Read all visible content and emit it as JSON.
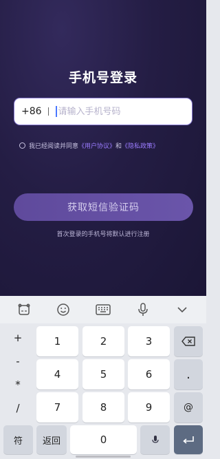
{
  "login": {
    "title": "手机号登录",
    "country_code": "+86",
    "phone_placeholder": "请输入手机号码",
    "phone_value": "",
    "agreement": {
      "prefix": "我已经阅读并同意",
      "user_agreement": "《用户协议》",
      "and": "和",
      "privacy_policy": "《隐私政策》"
    },
    "get_code_button": "获取短信验证码",
    "auto_register_hint": "首次登录的手机号将默认进行注册"
  },
  "keyboard": {
    "toolbar_icons": [
      "emoji-keyboard-icon",
      "smiley-icon",
      "keyboard-icon",
      "microphone-icon",
      "chevron-down-icon"
    ],
    "symbols": [
      "+",
      "-",
      "*",
      "/"
    ],
    "digits": [
      "1",
      "2",
      "3",
      "4",
      "5",
      "6",
      "7",
      "8",
      "9",
      "0"
    ],
    "dot": ".",
    "at": "@",
    "fu_label": "符",
    "back_label": "返回",
    "icons": {
      "backspace": "backspace-icon",
      "enter": "enter-icon",
      "voice": "microphone-icon"
    }
  },
  "colors": {
    "background_top": "#332a5c",
    "background_bottom": "#1b1636",
    "accent_link": "#9b7cff",
    "button": "#5f4a9c",
    "enter_key": "#5d6b82"
  }
}
